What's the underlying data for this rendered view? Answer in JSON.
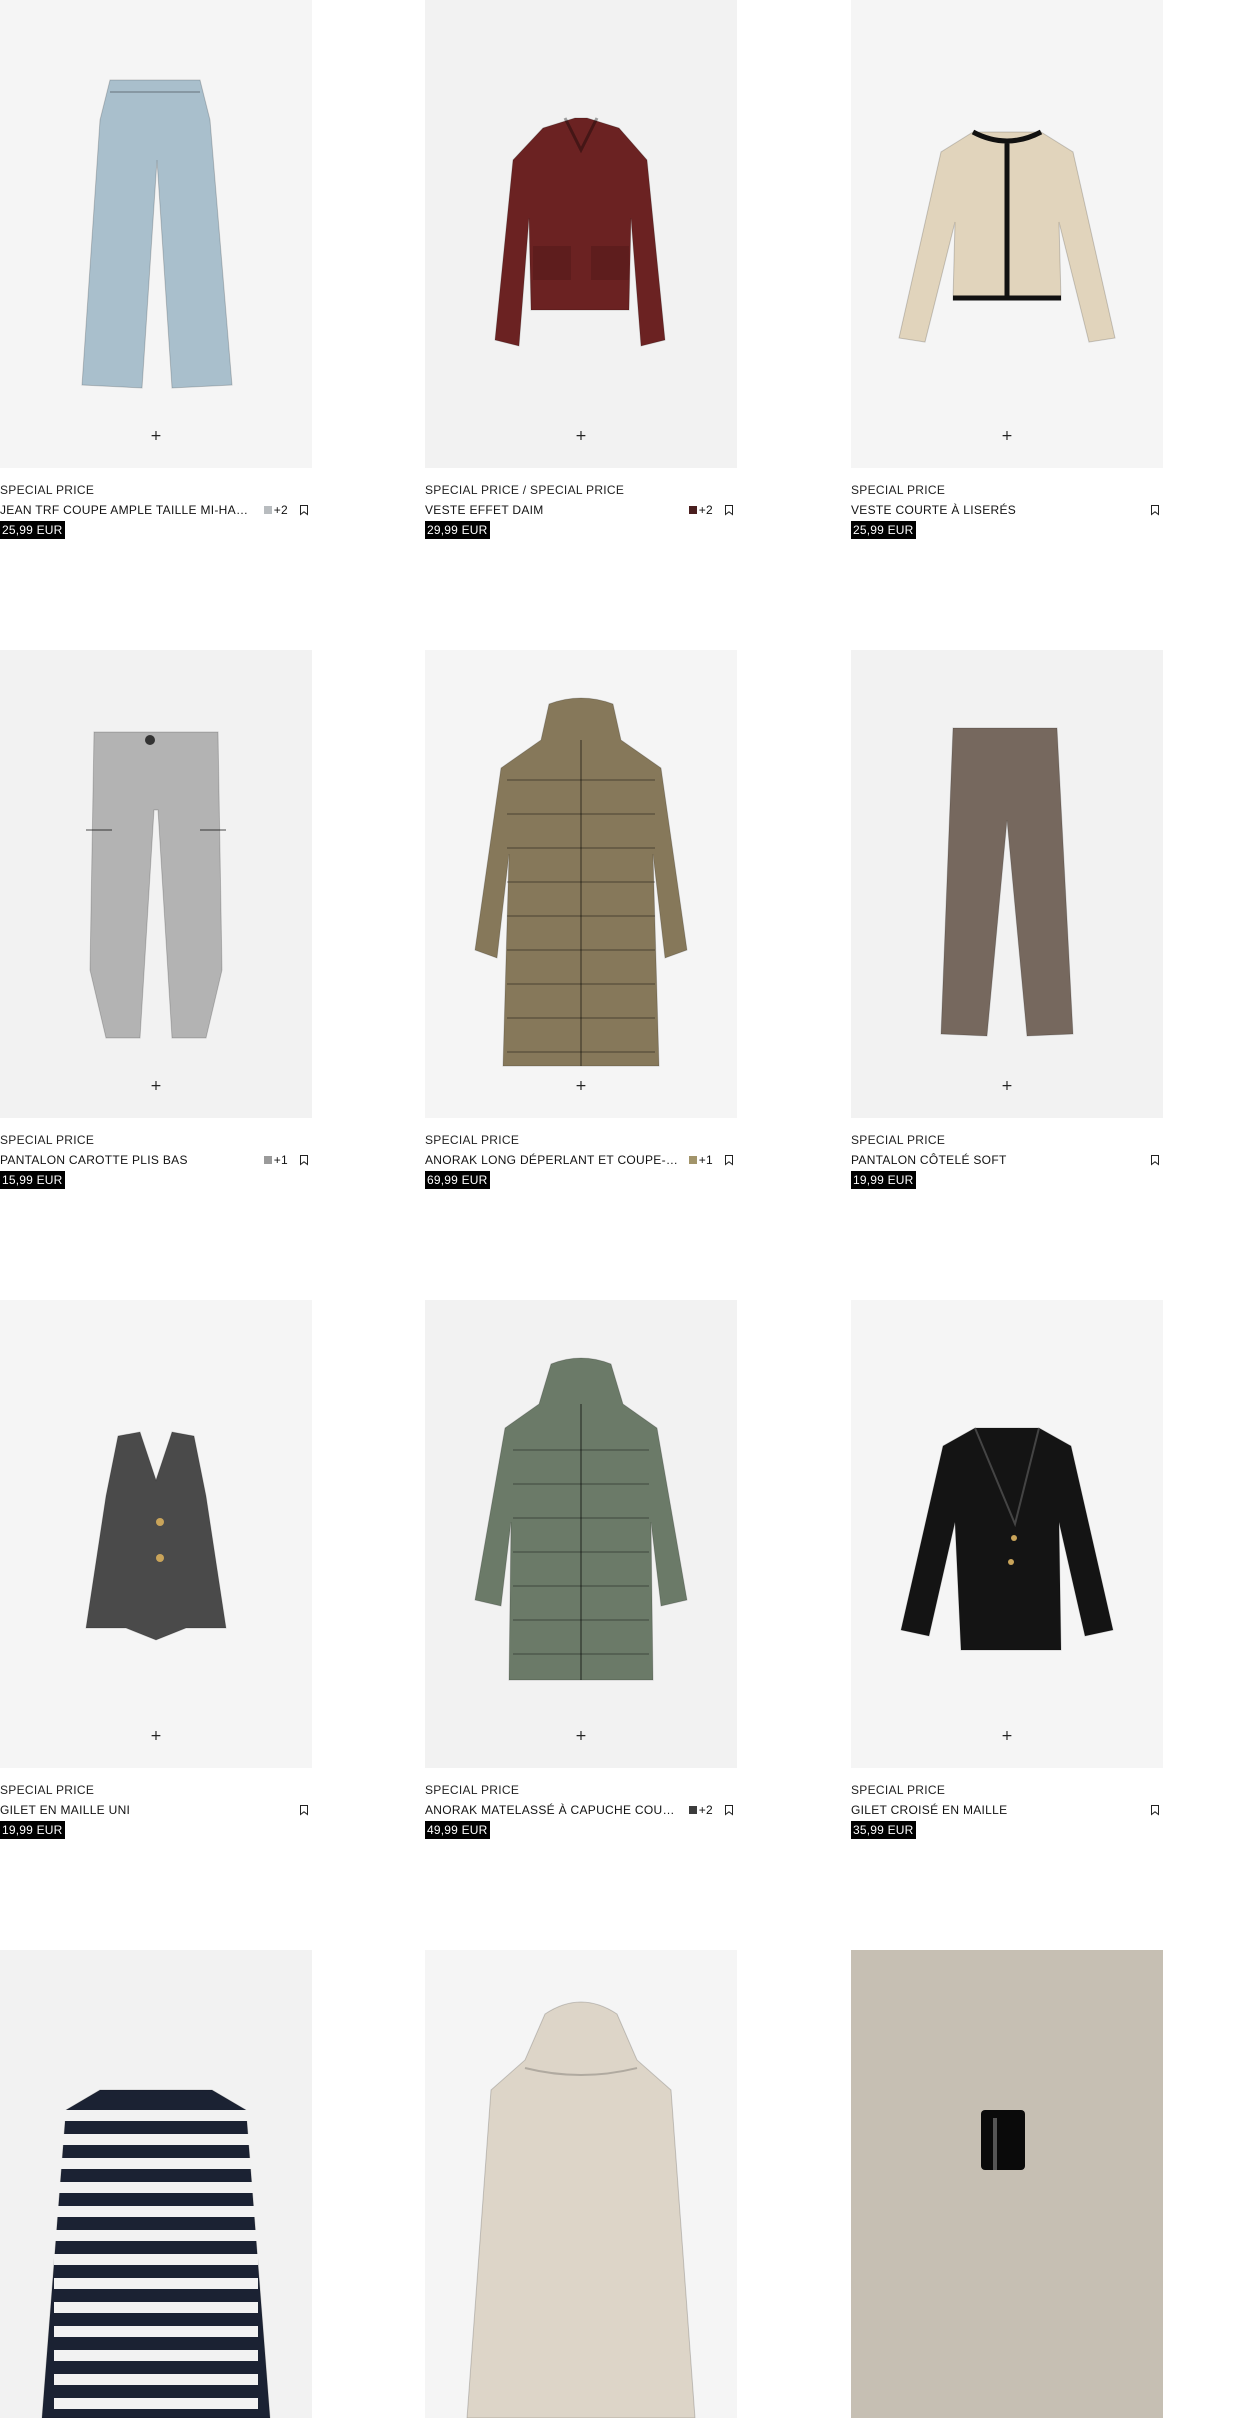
{
  "add_label": "+",
  "products": [
    {
      "tag": "Special Price",
      "name": "JEAN TRF COUPE AMPLE TAILLE MI-HAUTE",
      "swatch": "#b8bcbf",
      "more": "+2",
      "price": "25,99 EUR",
      "image_icon": "jeans-icon",
      "image_color": "#a9bfcc"
    },
    {
      "tag": "Special Price / Special Price",
      "name": "VESTE EFFET DAIM",
      "swatch": "#4a1f1f",
      "more": "+2",
      "price": "29,99 EUR",
      "image_icon": "jacket-icon",
      "image_color": "#6b2222"
    },
    {
      "tag": "Special Price",
      "name": "VESTE COURTE À LISERÉS",
      "swatch": "",
      "more": "",
      "price": "25,99 EUR",
      "image_icon": "cardigan-icon",
      "image_color": "#e1d4bc"
    },
    {
      "tag": "Special Price",
      "name": "PANTALON CAROTTE PLIS BAS",
      "swatch": "#9a9a9a",
      "more": "+1",
      "price": "15,99 EUR",
      "image_icon": "trousers-icon",
      "image_color": "#b3b3b3"
    },
    {
      "tag": "Special Price",
      "name": "ANORAK LONG DÉPERLANT ET COUPE-VENT",
      "swatch": "#a2946a",
      "more": "+1",
      "price": "69,99 EUR",
      "image_icon": "long-puffer-icon",
      "image_color": "#86785a"
    },
    {
      "tag": "Special Price",
      "name": "PANTALON CÔTELÉ SOFT",
      "swatch": "",
      "more": "",
      "price": "19,99 EUR",
      "image_icon": "wide-trousers-icon",
      "image_color": "#76685e"
    },
    {
      "tag": "Special Price",
      "name": "GILET EN MAILLE UNI",
      "swatch": "",
      "more": "",
      "price": "19,99 EUR",
      "image_icon": "vest-icon",
      "image_color": "#4a4a4a"
    },
    {
      "tag": "Special Price",
      "name": "ANORAK MATELASSÉ À CAPUCHE COURT",
      "swatch": "#3c3c3c",
      "more": "+2",
      "price": "49,99 EUR",
      "image_icon": "hooded-puffer-icon",
      "image_color": "#6b7a68"
    },
    {
      "tag": "Special Price",
      "name": "GILET CROISÉ EN MAILLE",
      "swatch": "",
      "more": "",
      "price": "35,99 EUR",
      "image_icon": "wrap-cardigan-icon",
      "image_color": "#141414"
    },
    {
      "tag": "",
      "name": "",
      "swatch": "",
      "more": "",
      "price": "",
      "image_icon": "striped-cardigan-icon",
      "image_color": "#1b2233"
    },
    {
      "tag": "",
      "name": "",
      "swatch": "",
      "more": "",
      "price": "",
      "image_icon": "cream-puffer-icon",
      "image_color": "#ddd5c8"
    },
    {
      "tag": "",
      "name": "",
      "swatch": "",
      "more": "",
      "price": "",
      "image_icon": "bottle-icon",
      "image_color": "#c6bfb3"
    }
  ]
}
